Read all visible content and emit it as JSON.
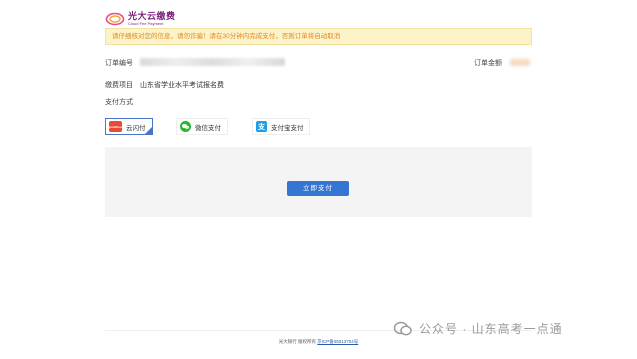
{
  "header": {
    "logo_cn": "光大云缴费",
    "logo_en": "Cloud Fee Payment"
  },
  "notice": {
    "text": "请仔细核对您的信息，请勿诈骗！请在30分钟内完成支付，否则订单将自动取消"
  },
  "order": {
    "order_no_label": "订单编号",
    "amount_label": "订单金额",
    "fee_item_label": "缴费项目",
    "fee_item_value": "山东省学业水平考试报名费",
    "pay_method_label": "支付方式"
  },
  "pay_options": [
    {
      "label": "云闪付",
      "icon": "unionpay-quickpass-icon",
      "selected": true,
      "icon_text": "QuickPass"
    },
    {
      "label": "微信支付",
      "icon": "wechat-pay-icon",
      "selected": false
    },
    {
      "label": "支付宝支付",
      "icon": "alipay-icon",
      "selected": false,
      "icon_text": "支"
    }
  ],
  "pay_button": {
    "label": "立即支付"
  },
  "footer": {
    "copyright": "光大银行  版权所有",
    "icp": "京ICP备05013704号"
  },
  "watermark": {
    "text": "公众号 · 山东高考一点通"
  },
  "colors": {
    "brand": "#7a1f7d",
    "notice_bg": "#fcf3c9",
    "notice_text": "#e08a2b",
    "primary_button": "#3476d2",
    "selected_border": "#4a74c9"
  }
}
